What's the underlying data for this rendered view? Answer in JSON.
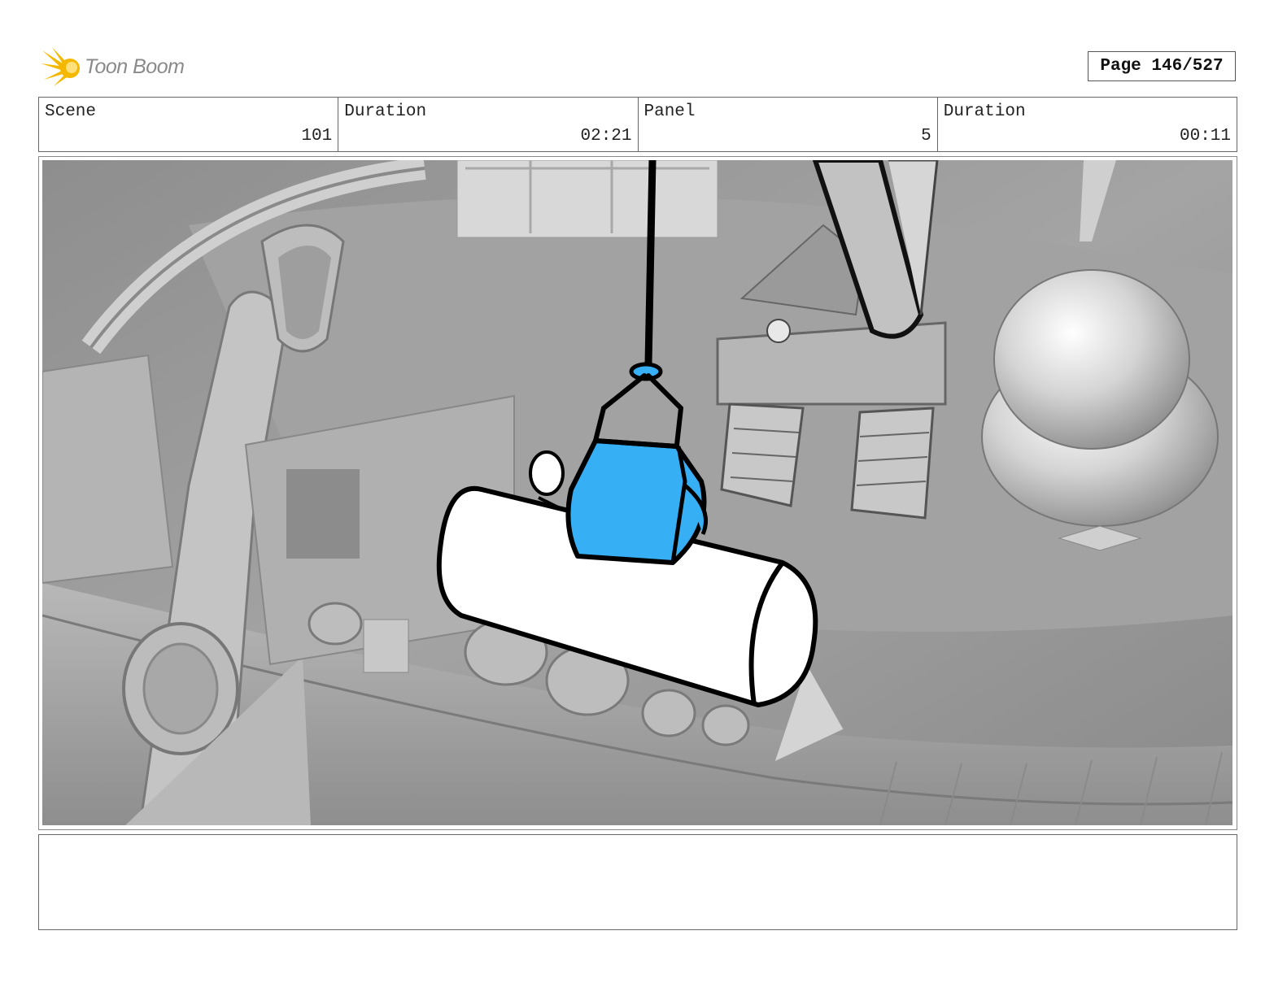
{
  "brand": {
    "logo_text": "Toon Boom",
    "logo_icon": "starburst-icon",
    "logo_color": "#f5b800"
  },
  "page_indicator": "Page 146/527",
  "info": {
    "scene_label": "Scene",
    "scene_value": "101",
    "scene_duration_label": "Duration",
    "scene_duration_value": "02:21",
    "panel_label": "Panel",
    "panel_value": "5",
    "panel_duration_label": "Duration",
    "panel_duration_value": "00:11"
  },
  "panel": {
    "accent_color": "#37aff5"
  },
  "notes": {
    "text": ""
  }
}
